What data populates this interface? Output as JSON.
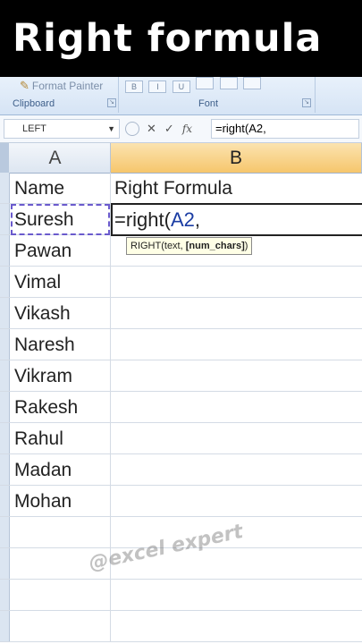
{
  "banner": {
    "title": "Right formula"
  },
  "ribbon": {
    "format_painter": "Format Painter",
    "clipboard_label": "Clipboard",
    "font_label": "Font",
    "font_buttons": [
      "B",
      "I",
      "U"
    ]
  },
  "formula_bar": {
    "name_box": "LEFT",
    "cancel_glyph": "✕",
    "enter_glyph": "✓",
    "fx_glyph": "fx",
    "formula": "=right(A2,"
  },
  "columns": {
    "a": "A",
    "b": "B"
  },
  "rows": [
    {
      "a": "Name",
      "b": "Right Formula"
    },
    {
      "a": "Suresh",
      "b": ""
    },
    {
      "a": "Pawan",
      "b": ""
    },
    {
      "a": "Vimal",
      "b": ""
    },
    {
      "a": "Vikash",
      "b": ""
    },
    {
      "a": "Naresh",
      "b": ""
    },
    {
      "a": "Vikram",
      "b": ""
    },
    {
      "a": "Rakesh",
      "b": ""
    },
    {
      "a": "Rahul",
      "b": ""
    },
    {
      "a": "Madan",
      "b": ""
    },
    {
      "a": "Mohan",
      "b": ""
    },
    {
      "a": "",
      "b": ""
    },
    {
      "a": "",
      "b": ""
    },
    {
      "a": "",
      "b": ""
    },
    {
      "a": "",
      "b": ""
    }
  ],
  "editing_cell": {
    "prefix": "=right(",
    "ref": "A2",
    "suffix": ","
  },
  "tooltip": {
    "func": "RIGHT(text, ",
    "arg": "[num_chars]",
    "close": ")"
  },
  "watermark": "@excel expert"
}
